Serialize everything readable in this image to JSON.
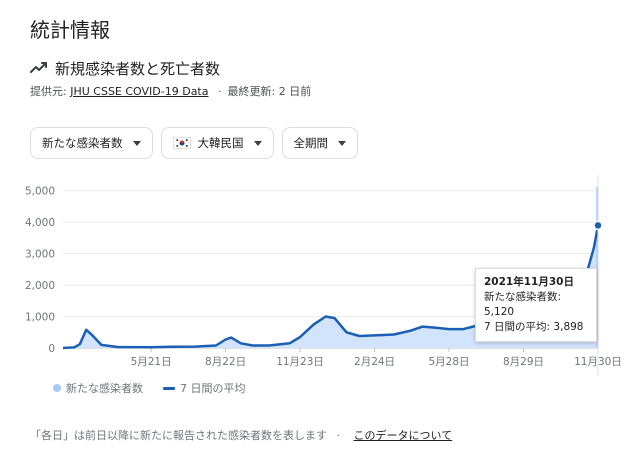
{
  "page": {
    "title": "統計情報",
    "subtitle": "新規感染者数と死亡者数",
    "source_prefix": "提供元:",
    "source_link": "JHU CSSE COVID-19 Data",
    "source_separator": "·",
    "last_updated": "最終更新: 2 日前"
  },
  "icons": {
    "trend": "trending-up-icon",
    "flag": "south-korea-flag-icon",
    "caret": "caret-down-icon"
  },
  "filters": [
    {
      "label": "新たな感染者数"
    },
    {
      "label": "大韓民国"
    },
    {
      "label": "全期間"
    }
  ],
  "tooltip": {
    "date": "2021年11月30日",
    "cases_label": "新たな感染者数",
    "cases_value": "5,120",
    "avg_label": "7 日間の平均",
    "avg_value": "3,898"
  },
  "legend": {
    "cases": "新たな感染者数",
    "average": "7 日間の平均"
  },
  "footnote": {
    "text": "「各日」は前日以降に新たに報告された感染者数を表します",
    "separator": "·",
    "link": "このデータについて"
  },
  "colors": {
    "bars": "#a8c7fa",
    "area": "#d2e3fc",
    "line": "#1a5fb4",
    "grid": "#e8eaed",
    "axis_text": "#70757a"
  },
  "chart_data": {
    "type": "bar",
    "x_start": "2020-02-01",
    "x_end": "2021-11-30",
    "ylim": [
      0,
      5500
    ],
    "yticks": [
      0,
      1000,
      2000,
      3000,
      4000,
      5000
    ],
    "ytick_labels": [
      "0",
      "1,000",
      "2,000",
      "3,000",
      "4,000",
      "5,000"
    ],
    "xticks": [
      "2020-05-21",
      "2020-08-22",
      "2020-11-23",
      "2021-02-24",
      "2021-05-28",
      "2021-08-29",
      "2021-11-30"
    ],
    "xtick_labels": [
      "5月21日",
      "8月22日",
      "11月23日",
      "2月24日",
      "5月28日",
      "8月29日",
      "11月30日"
    ],
    "series": [
      {
        "name": "7 日間の平均",
        "x": [
          "2020-02-01",
          "2020-02-15",
          "2020-02-22",
          "2020-03-01",
          "2020-03-08",
          "2020-03-20",
          "2020-04-10",
          "2020-05-21",
          "2020-06-15",
          "2020-07-15",
          "2020-08-10",
          "2020-08-22",
          "2020-08-29",
          "2020-09-10",
          "2020-09-25",
          "2020-10-15",
          "2020-11-10",
          "2020-11-23",
          "2020-12-10",
          "2020-12-25",
          "2021-01-05",
          "2021-01-20",
          "2021-02-05",
          "2021-02-24",
          "2021-03-20",
          "2021-04-10",
          "2021-04-25",
          "2021-05-10",
          "2021-05-28",
          "2021-06-15",
          "2021-06-30",
          "2021-07-10",
          "2021-07-25",
          "2021-08-10",
          "2021-08-29",
          "2021-09-15",
          "2021-09-25",
          "2021-10-10",
          "2021-10-25",
          "2021-11-05",
          "2021-11-15",
          "2021-11-25",
          "2021-11-30"
        ],
        "values": [
          0,
          20,
          120,
          580,
          420,
          100,
          30,
          25,
          40,
          45,
          80,
          270,
          330,
          150,
          80,
          80,
          150,
          350,
          750,
          1000,
          950,
          500,
          380,
          400,
          430,
          550,
          680,
          650,
          600,
          600,
          700,
          1300,
          1600,
          1750,
          1650,
          1750,
          2300,
          1800,
          1600,
          1900,
          2300,
          3200,
          3898
        ]
      },
      {
        "name": "新たな感染者数",
        "highlight_date": "2021-11-30",
        "highlight_value": 5120
      }
    ]
  }
}
